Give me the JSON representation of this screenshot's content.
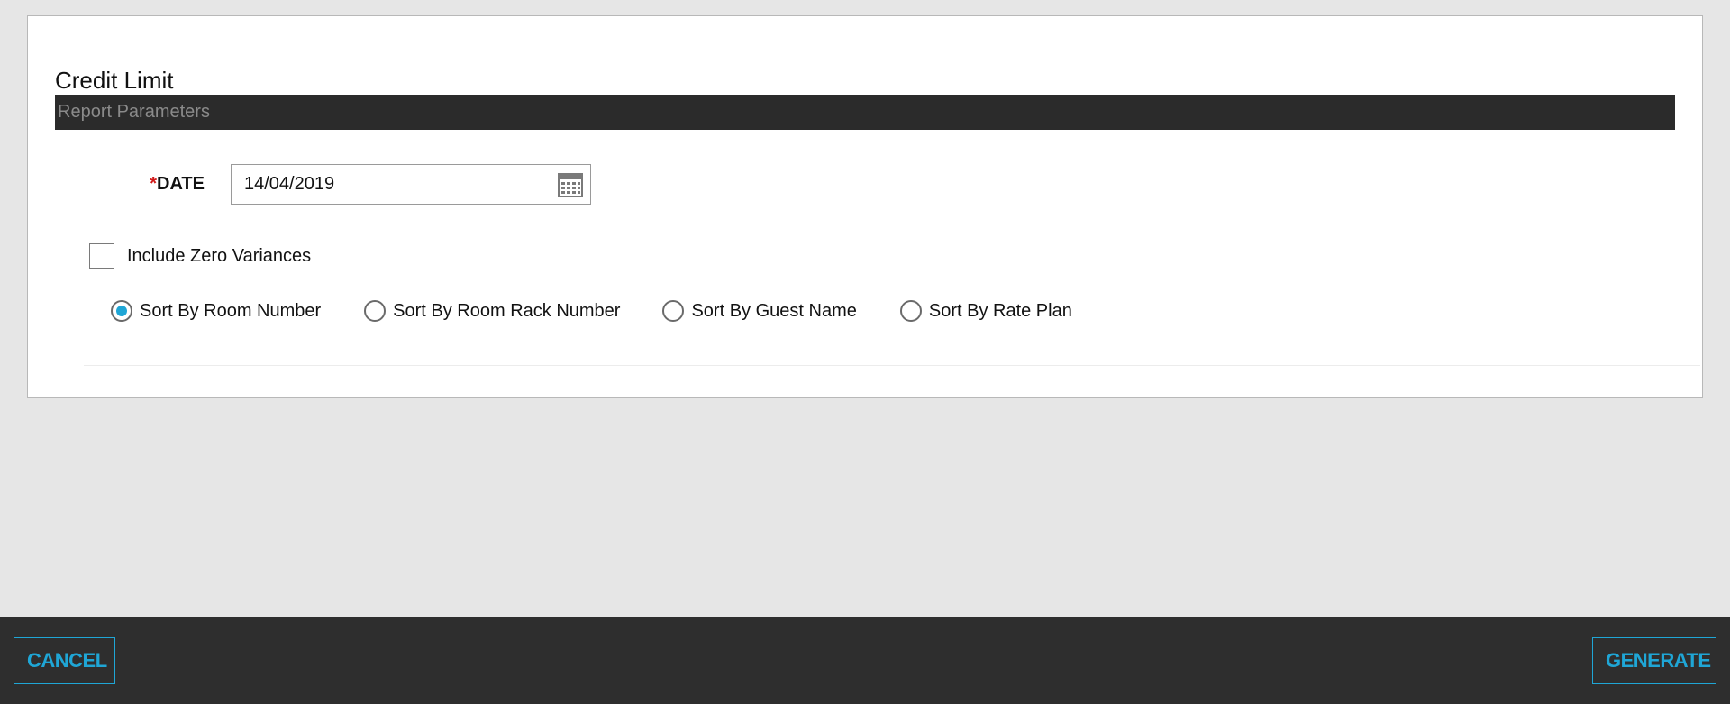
{
  "page": {
    "title": "Credit Limit",
    "section_title": "Report Parameters"
  },
  "form": {
    "date": {
      "required_marker": "*",
      "label": "DATE",
      "value": "14/04/2019"
    },
    "include_zero_variances": {
      "label": "Include Zero Variances",
      "checked": false
    },
    "sort_options": [
      {
        "label": "Sort By Room Number",
        "selected": true
      },
      {
        "label": "Sort By Room Rack Number",
        "selected": false
      },
      {
        "label": "Sort By Guest Name",
        "selected": false
      },
      {
        "label": "Sort By Rate Plan",
        "selected": false
      }
    ]
  },
  "footer": {
    "cancel_label": "CANCEL",
    "generate_label": "GENERATE"
  },
  "colors": {
    "accent": "#1fa6d6",
    "required": "#d11a1a",
    "bar_background": "#2b2b2b",
    "footer_background": "#2e2e2e"
  },
  "icons": {
    "date_picker": "calendar-icon"
  }
}
